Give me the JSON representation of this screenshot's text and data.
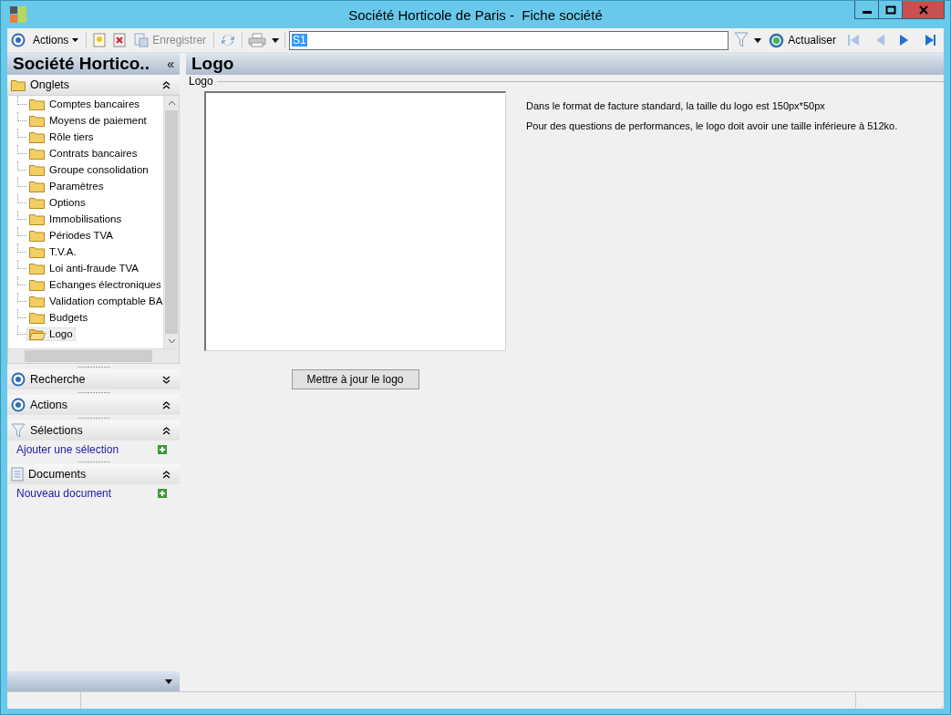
{
  "window": {
    "title": "Société Horticole de Paris -  Fiche société"
  },
  "toolbar": {
    "actions_menu": "Actions",
    "save": {
      "label": "Enregistrer",
      "disabled": true
    },
    "search_value": "S1",
    "refresh": "Actualiser",
    "nav_buttons": [
      {
        "disabled": true
      },
      {
        "disabled": true
      },
      {
        "disabled": false
      },
      {
        "disabled": false
      }
    ]
  },
  "sidebar": {
    "title": "Société Hortico..",
    "collapse": "«",
    "tabs_group": {
      "label": "Onglets",
      "expanded": true,
      "items": [
        {
          "label": "Comptes bancaires",
          "selected": false
        },
        {
          "label": "Moyens de paiement",
          "selected": false
        },
        {
          "label": "Rôle tiers",
          "selected": false
        },
        {
          "label": "Contrats bancaires",
          "selected": false
        },
        {
          "label": "Groupe consolidation",
          "selected": false
        },
        {
          "label": "Paramètres",
          "selected": false
        },
        {
          "label": "Options",
          "selected": false
        },
        {
          "label": "Immobilisations",
          "selected": false
        },
        {
          "label": "Périodes TVA",
          "selected": false
        },
        {
          "label": "T.V.A.",
          "selected": false
        },
        {
          "label": "Loi anti-fraude TVA",
          "selected": false
        },
        {
          "label": "Echanges électroniques",
          "selected": false
        },
        {
          "label": "Validation comptable BA",
          "selected": false
        },
        {
          "label": "Budgets",
          "selected": false
        },
        {
          "label": "Logo",
          "selected": true
        }
      ]
    },
    "sections": [
      {
        "kind": "target",
        "label": "Recherche",
        "expanded": false
      },
      {
        "kind": "target",
        "label": "Actions",
        "expanded": true
      },
      {
        "kind": "filter",
        "label": "Sélections",
        "expanded": true,
        "link": "Ajouter une sélection"
      },
      {
        "kind": "document",
        "label": "Documents",
        "expanded": true,
        "link": "Nouveau document"
      }
    ]
  },
  "main": {
    "title": "Logo",
    "group_label": "Logo",
    "notes": [
      "Dans le format de facture standard, la taille du logo est 150px*50px",
      "Pour des questions de performances, le logo doit avoir une taille inférieure à 512ko."
    ],
    "update_button": "Mettre à jour le logo"
  }
}
